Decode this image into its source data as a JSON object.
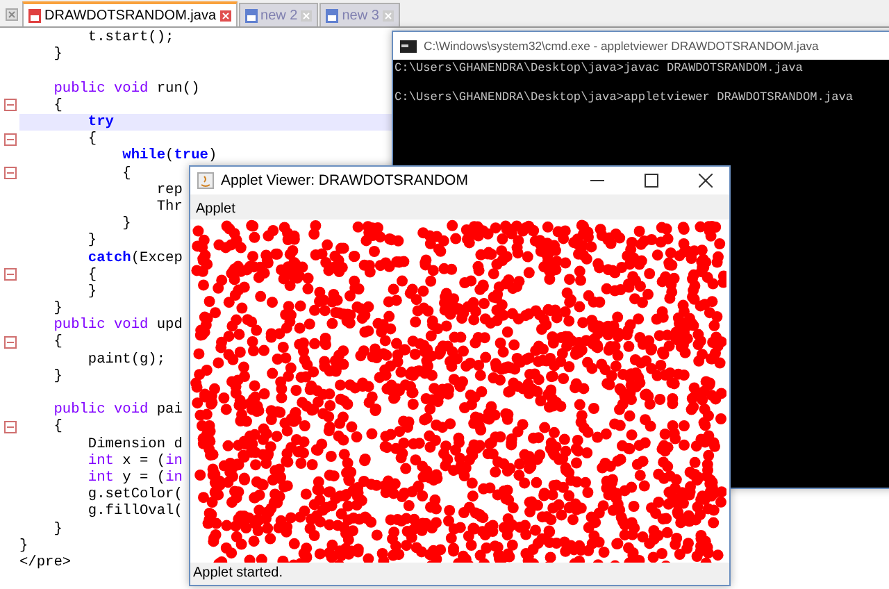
{
  "editor": {
    "tabs": [
      {
        "label": "DRAWDOTSRANDOM.java",
        "selected": true
      },
      {
        "label": "new 2",
        "selected": false
      },
      {
        "label": "new 3",
        "selected": false
      }
    ],
    "lines": [
      {
        "current": false,
        "fold_marker": false,
        "segments": [
          {
            "text": "        t.start();",
            "kind": "plain"
          }
        ]
      },
      {
        "current": false,
        "fold_marker": false,
        "segments": [
          {
            "text": "    }",
            "kind": "plain"
          }
        ]
      },
      {
        "current": false,
        "fold_marker": false
      },
      {
        "current": false,
        "fold_marker": false,
        "segments": [
          {
            "text": "    public",
            "kind": "keyword"
          },
          {
            "text": " void",
            "kind": "keyword"
          },
          {
            "text": " run()",
            "kind": "plain"
          }
        ]
      },
      {
        "current": false,
        "fold_marker": true,
        "segments": [
          {
            "text": "    {",
            "kind": "plain"
          }
        ]
      },
      {
        "current": true,
        "fold_marker": false,
        "segments": [
          {
            "text": "        try",
            "kind": "control"
          }
        ]
      },
      {
        "current": false,
        "fold_marker": true,
        "segments": [
          {
            "text": "        {",
            "kind": "plain"
          }
        ]
      },
      {
        "current": false,
        "fold_marker": false,
        "segments": [
          {
            "text": "            while",
            "kind": "control"
          },
          {
            "text": "(",
            "kind": "plain"
          },
          {
            "text": "true",
            "kind": "control"
          },
          {
            "text": ")",
            "kind": "plain"
          }
        ]
      },
      {
        "current": false,
        "fold_marker": true,
        "segments": [
          {
            "text": "            {",
            "kind": "plain"
          }
        ]
      },
      {
        "current": false,
        "fold_marker": false,
        "segments": [
          {
            "text": "                rep",
            "kind": "plain"
          }
        ]
      },
      {
        "current": false,
        "fold_marker": false,
        "segments": [
          {
            "text": "                Thr",
            "kind": "plain"
          }
        ]
      },
      {
        "current": false,
        "fold_marker": false,
        "segments": [
          {
            "text": "            }",
            "kind": "plain"
          }
        ]
      },
      {
        "current": false,
        "fold_marker": false,
        "segments": [
          {
            "text": "        }",
            "kind": "plain"
          }
        ]
      },
      {
        "current": false,
        "fold_marker": false,
        "segments": [
          {
            "text": "        catch",
            "kind": "control"
          },
          {
            "text": "(Excep",
            "kind": "plain"
          }
        ]
      },
      {
        "current": false,
        "fold_marker": true,
        "segments": [
          {
            "text": "        {",
            "kind": "plain"
          }
        ]
      },
      {
        "current": false,
        "fold_marker": false,
        "segments": [
          {
            "text": "        }",
            "kind": "plain"
          }
        ]
      },
      {
        "current": false,
        "fold_marker": false,
        "segments": [
          {
            "text": "    }",
            "kind": "plain"
          }
        ]
      },
      {
        "current": false,
        "fold_marker": false,
        "segments": [
          {
            "text": "    public",
            "kind": "keyword"
          },
          {
            "text": " void",
            "kind": "keyword"
          },
          {
            "text": " upd",
            "kind": "plain"
          }
        ]
      },
      {
        "current": false,
        "fold_marker": true,
        "segments": [
          {
            "text": "    {",
            "kind": "plain"
          }
        ]
      },
      {
        "current": false,
        "fold_marker": false,
        "segments": [
          {
            "text": "        paint(g);",
            "kind": "plain"
          }
        ]
      },
      {
        "current": false,
        "fold_marker": false,
        "segments": [
          {
            "text": "    }",
            "kind": "plain"
          }
        ]
      },
      {
        "current": false,
        "fold_marker": false
      },
      {
        "current": false,
        "fold_marker": false,
        "segments": [
          {
            "text": "    public",
            "kind": "keyword"
          },
          {
            "text": " void",
            "kind": "keyword"
          },
          {
            "text": " pai",
            "kind": "plain"
          }
        ]
      },
      {
        "current": false,
        "fold_marker": true,
        "segments": [
          {
            "text": "    {",
            "kind": "plain"
          }
        ]
      },
      {
        "current": false,
        "fold_marker": false,
        "segments": [
          {
            "text": "        Dimension d",
            "kind": "plain"
          }
        ]
      },
      {
        "current": false,
        "fold_marker": false,
        "segments": [
          {
            "text": "        int",
            "kind": "keyword"
          },
          {
            "text": " x = (",
            "kind": "plain"
          },
          {
            "text": "in",
            "kind": "keyword"
          }
        ]
      },
      {
        "current": false,
        "fold_marker": false,
        "segments": [
          {
            "text": "        int",
            "kind": "keyword"
          },
          {
            "text": " y = (",
            "kind": "plain"
          },
          {
            "text": "in",
            "kind": "keyword"
          }
        ]
      },
      {
        "current": false,
        "fold_marker": false,
        "segments": [
          {
            "text": "        g.setColor(",
            "kind": "plain"
          }
        ]
      },
      {
        "current": false,
        "fold_marker": false,
        "segments": [
          {
            "text": "        g.fillOval(",
            "kind": "plain"
          }
        ]
      },
      {
        "current": false,
        "fold_marker": false,
        "segments": [
          {
            "text": "    }",
            "kind": "plain"
          }
        ]
      },
      {
        "current": false,
        "fold_marker": false,
        "segments": [
          {
            "text": "}",
            "kind": "plain"
          }
        ]
      },
      {
        "current": false,
        "fold_marker": false,
        "segments": [
          {
            "text": "</pre>",
            "kind": "plain"
          }
        ]
      }
    ]
  },
  "console": {
    "title": "C:\\Windows\\system32\\cmd.exe - appletviewer  DRAWDOTSRANDOM.java",
    "lines": [
      "C:\\Users\\GHANENDRA\\Desktop\\java>javac DRAWDOTSRANDOM.java",
      "C:\\Users\\GHANENDRA\\Desktop\\java>appletviewer DRAWDOTSRANDOM.java"
    ]
  },
  "applet_viewer": {
    "title": "Applet Viewer: DRAWDOTSRANDOM",
    "menu": "Applet",
    "status": "Applet started."
  }
}
